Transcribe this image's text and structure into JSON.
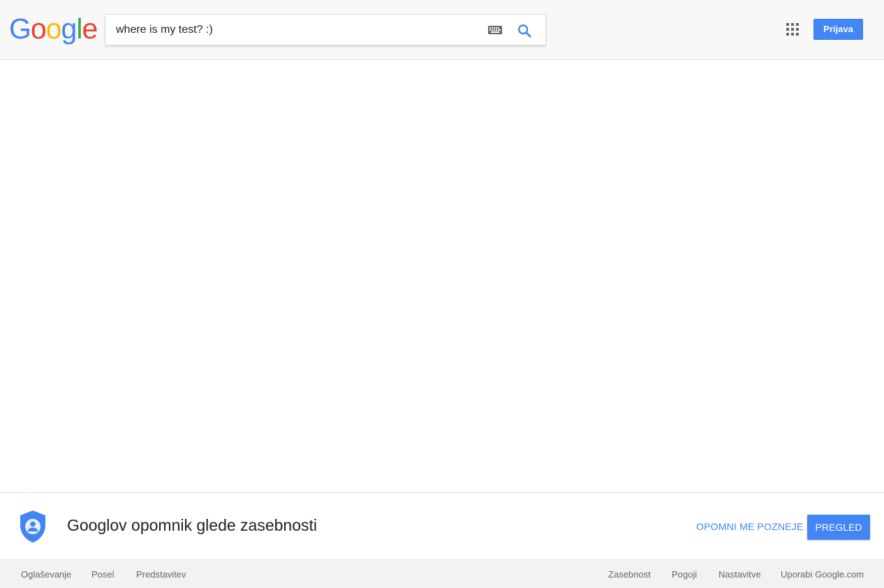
{
  "header": {
    "logo_letters": [
      {
        "char": "G",
        "color": "#4285f4"
      },
      {
        "char": "o",
        "color": "#ea4335"
      },
      {
        "char": "o",
        "color": "#fbbc05"
      },
      {
        "char": "g",
        "color": "#4285f4"
      },
      {
        "char": "l",
        "color": "#34a853"
      },
      {
        "char": "e",
        "color": "#ea4335"
      }
    ],
    "search_value": "where is my test? :)",
    "keyboard_icon": "keyboard-icon",
    "search_icon": "magnifier-icon",
    "apps_icon": "grid-icon",
    "signin_label": "Prijava"
  },
  "privacy": {
    "icon": "shield-person-icon",
    "title": "Googlov opomnik glede zasebnosti",
    "remind_later": "OPOMNI ME POZNEJE",
    "review": "PREGLED"
  },
  "footer": {
    "left": [
      "Oglaševanje",
      "Posel",
      "Predstavitev"
    ],
    "right": [
      "Zasebnost",
      "Pogoji",
      "Nastavitve",
      "Uporabi Google.com"
    ]
  },
  "colors": {
    "accent": "#4285f4",
    "header_bg": "#f8f8f8",
    "footer_bg": "#f2f2f2"
  }
}
